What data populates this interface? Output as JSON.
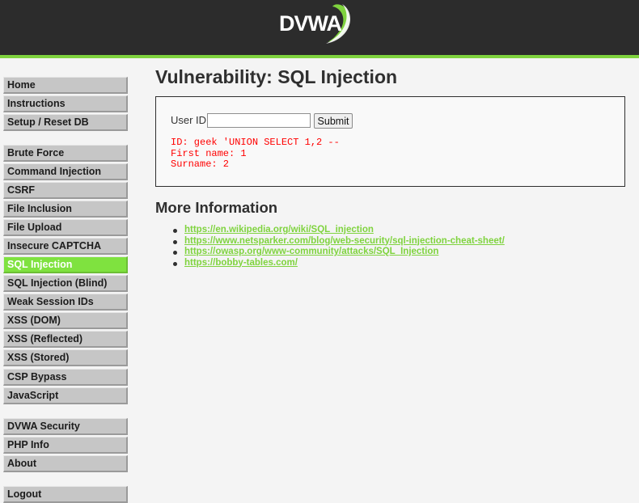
{
  "header": {
    "logo_text": "DVWA"
  },
  "menu": {
    "group1": [
      {
        "label": "Home"
      },
      {
        "label": "Instructions"
      },
      {
        "label": "Setup / Reset DB"
      }
    ],
    "group2": [
      {
        "label": "Brute Force"
      },
      {
        "label": "Command Injection"
      },
      {
        "label": "CSRF"
      },
      {
        "label": "File Inclusion"
      },
      {
        "label": "File Upload"
      },
      {
        "label": "Insecure CAPTCHA"
      },
      {
        "label": "SQL Injection",
        "selected": true
      },
      {
        "label": "SQL Injection (Blind)"
      },
      {
        "label": "Weak Session IDs"
      },
      {
        "label": "XSS (DOM)"
      },
      {
        "label": "XSS (Reflected)"
      },
      {
        "label": "XSS (Stored)"
      },
      {
        "label": "CSP Bypass"
      },
      {
        "label": "JavaScript"
      }
    ],
    "group3": [
      {
        "label": "DVWA Security"
      },
      {
        "label": "PHP Info"
      },
      {
        "label": "About"
      }
    ],
    "group4": [
      {
        "label": "Logout"
      }
    ]
  },
  "main": {
    "title": "Vulnerability: SQL Injection",
    "form": {
      "label": "User ID:",
      "input_value": "",
      "submit_label": "Submit"
    },
    "result": {
      "line1": "ID: geek 'UNION SELECT 1,2 --",
      "line2": "First name: 1",
      "line3": "Surname: 2"
    },
    "more_info_title": "More Information",
    "links": [
      "https://en.wikipedia.org/wiki/SQL_injection",
      "https://www.netsparker.com/blog/web-security/sql-injection-cheat-sheet/",
      "https://owasp.org/www-community/attacks/SQL_Injection",
      "https://bobby-tables.com/"
    ]
  },
  "colors": {
    "header_bg": "#2c2c2c",
    "accent_green": "#7fd33e",
    "menu_bg": "#c6c6c6",
    "error_red": "#ff0000"
  }
}
